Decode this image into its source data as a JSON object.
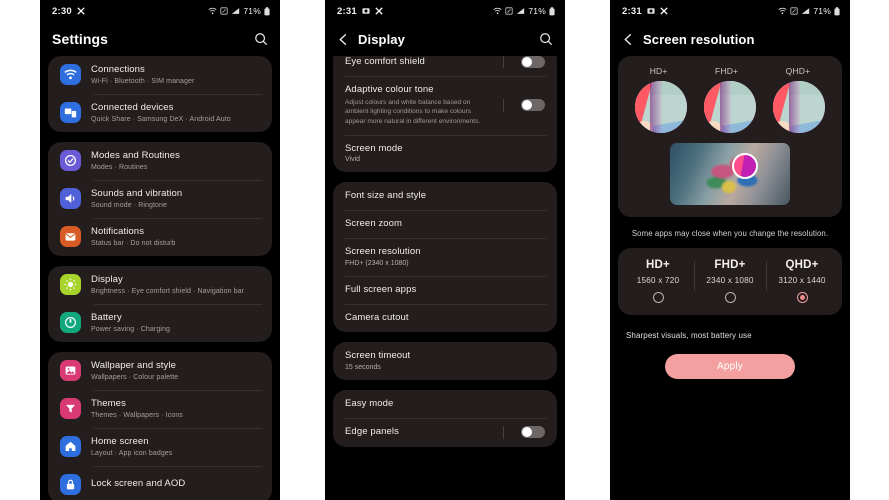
{
  "phone1": {
    "status": {
      "time": "2:30",
      "icons": [
        "x-app-icon"
      ],
      "right_icons": [
        "wifi-icon",
        "nfc-icon",
        "signal-icon"
      ],
      "battery": "71%",
      "battery_icon": "battery-icon"
    },
    "appbar": {
      "title": "Settings",
      "search_icon": "search-icon"
    },
    "groups": [
      {
        "items": [
          {
            "title": "Connections",
            "subtitle": "Wi-Fi  ·  Bluetooth  ·  SIM manager",
            "icon": "wifi-icon",
            "color": "#2f6ede"
          },
          {
            "title": "Connected devices",
            "subtitle": "Quick Share  ·  Samsung DeX  ·  Android Auto",
            "icon": "connected-devices-icon",
            "color": "#2f6ede"
          }
        ]
      },
      {
        "items": [
          {
            "title": "Modes and Routines",
            "subtitle": "Modes  ·  Routines",
            "icon": "modes-routines-icon",
            "color": "#6b5bd6"
          },
          {
            "title": "Sounds and vibration",
            "subtitle": "Sound mode  ·  Ringtone",
            "icon": "sound-icon",
            "color": "#5060d8"
          },
          {
            "title": "Notifications",
            "subtitle": "Status bar  ·  Do not disturb",
            "icon": "notifications-icon",
            "color": "#d85b26"
          }
        ]
      },
      {
        "items": [
          {
            "title": "Display",
            "subtitle": "Brightness  ·  Eye comfort shield  ·  Navigation bar",
            "icon": "display-icon",
            "color": "#a8d32a"
          },
          {
            "title": "Battery",
            "subtitle": "Power saving  ·  Charging",
            "icon": "battery-icon",
            "color": "#11a87d"
          }
        ]
      },
      {
        "items": [
          {
            "title": "Wallpaper and style",
            "subtitle": "Wallpapers  ·  Colour palette",
            "icon": "wallpaper-icon",
            "color": "#d93a73"
          },
          {
            "title": "Themes",
            "subtitle": "Themes  ·  Wallpapers  ·  Icons",
            "icon": "themes-icon",
            "color": "#d93a73"
          },
          {
            "title": "Home screen",
            "subtitle": "Layout  ·  App icon badges",
            "icon": "home-screen-icon",
            "color": "#2f6ede"
          },
          {
            "title": "Lock screen and AOD",
            "subtitle": "",
            "icon": "lock-screen-icon",
            "color": "#2f6ede"
          }
        ]
      }
    ]
  },
  "phone2": {
    "status": {
      "time": "2:31",
      "icons": [
        "screenshot-icon",
        "x-app-icon"
      ],
      "right_icons": [
        "wifi-icon",
        "nfc-icon",
        "signal-icon"
      ],
      "battery": "71%",
      "battery_icon": "battery-icon"
    },
    "appbar": {
      "back_icon": "back-arrow-icon",
      "title": "Display",
      "search_icon": "search-icon"
    },
    "groups": [
      {
        "items": [
          {
            "title": "Eye comfort shield",
            "subtitle": "",
            "toggle": "off",
            "clipped": true
          },
          {
            "title": "Adaptive colour tone",
            "desc": "Adjust colours and white balance based on ambient lighting conditions to make colours appear more natural in different environments.",
            "toggle": "off"
          },
          {
            "title": "Screen mode",
            "value": "Vivid"
          }
        ]
      },
      {
        "items": [
          {
            "title": "Font size and style"
          },
          {
            "title": "Screen zoom"
          },
          {
            "title": "Screen resolution",
            "value": "FHD+ (2340 x 1080)"
          },
          {
            "title": "Full screen apps"
          },
          {
            "title": "Camera cutout"
          }
        ]
      },
      {
        "items": [
          {
            "title": "Screen timeout",
            "value": "15 seconds"
          }
        ]
      },
      {
        "items": [
          {
            "title": "Easy mode"
          },
          {
            "title": "Edge panels",
            "toggle": "off"
          }
        ]
      }
    ]
  },
  "phone3": {
    "status": {
      "time": "2:31",
      "icons": [
        "screenshot-icon",
        "x-app-icon"
      ],
      "right_icons": [
        "wifi-icon",
        "nfc-icon",
        "signal-icon"
      ],
      "battery": "71%",
      "battery_icon": "battery-icon"
    },
    "appbar": {
      "back_icon": "back-arrow-icon",
      "title": "Screen resolution"
    },
    "preview_labels": [
      "HD+",
      "FHD+",
      "QHD+"
    ],
    "note": "Some apps may close when you change the resolution.",
    "options": [
      {
        "label": "HD+",
        "dimensions": "1560 x 720",
        "selected": false
      },
      {
        "label": "FHD+",
        "dimensions": "2340 x 1080",
        "selected": false
      },
      {
        "label": "QHD+",
        "dimensions": "3120 x 1440",
        "selected": true
      }
    ],
    "hint": "Sharpest visuals, most battery use",
    "apply_label": "Apply",
    "accent": "#f4a0a0"
  }
}
